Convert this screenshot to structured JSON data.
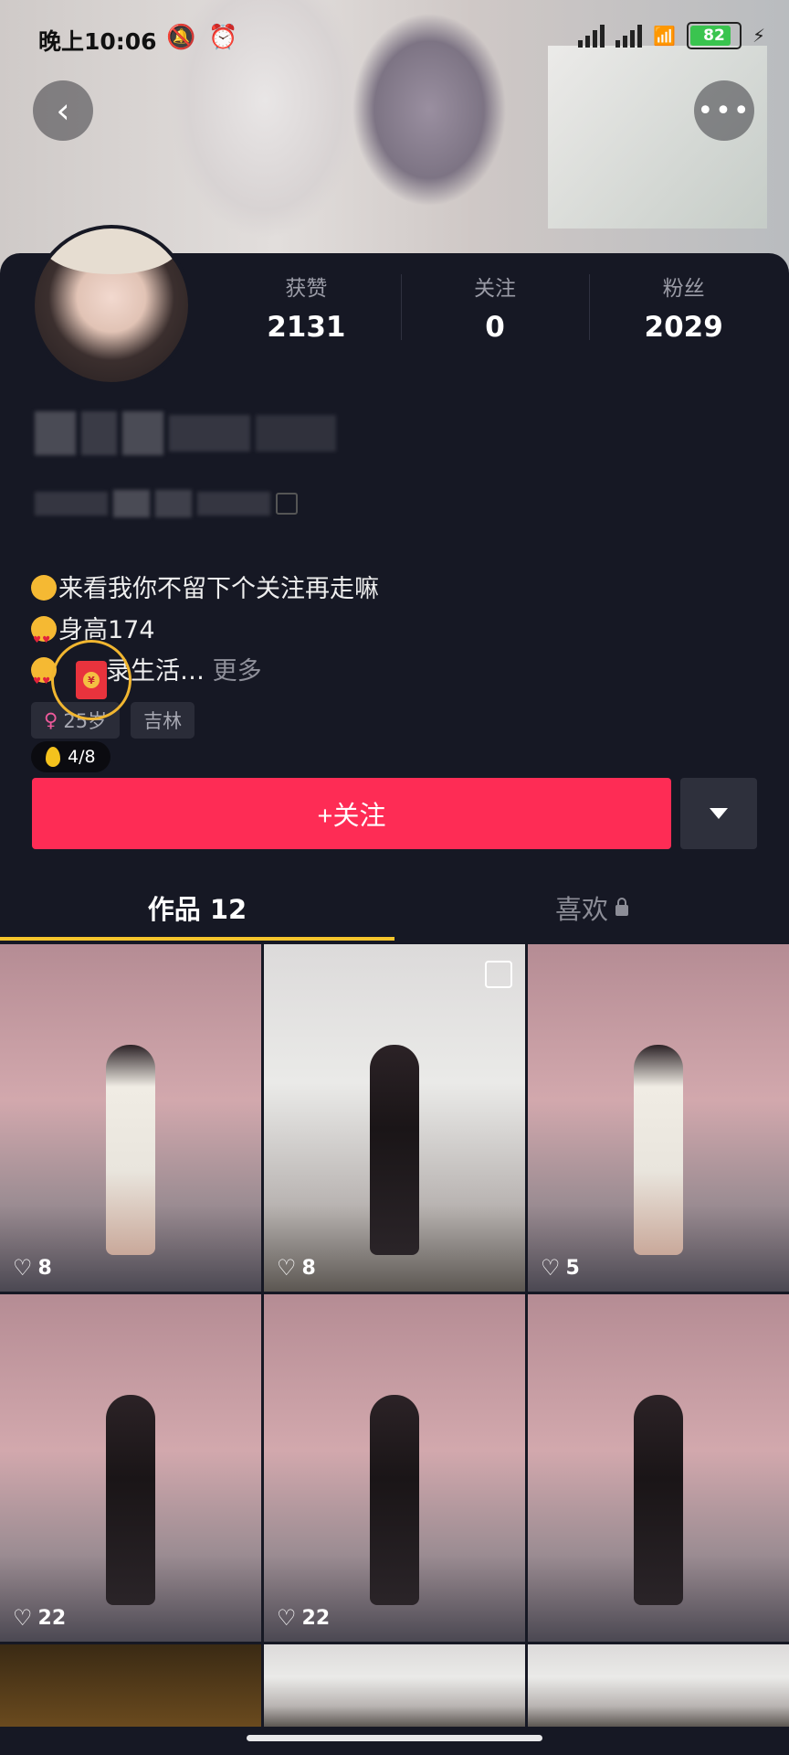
{
  "status_bar": {
    "time": "晚上10:06",
    "battery": "82"
  },
  "profile": {
    "stats": [
      {
        "label": "获赞",
        "value": "2131"
      },
      {
        "label": "关注",
        "value": "0"
      },
      {
        "label": "粉丝",
        "value": "2029"
      }
    ],
    "bio_lines": [
      "来看我你不留下个关注再走嘛",
      "身高174",
      "录生活…"
    ],
    "bio_more": "更多",
    "tags": {
      "age": "25岁",
      "location": "吉林"
    },
    "coin_progress": "4/8"
  },
  "actions": {
    "follow_label": "+关注"
  },
  "tabs": [
    {
      "label": "作品 12"
    },
    {
      "label": "喜欢"
    }
  ],
  "posts": [
    {
      "likes": "8"
    },
    {
      "likes": "8"
    },
    {
      "likes": "5"
    },
    {
      "likes": "22"
    },
    {
      "likes": "22"
    },
    {
      "likes": ""
    }
  ],
  "icons": {
    "back": "back-icon",
    "more": "more-icon",
    "copy": "copy-icon",
    "heart": "heart-icon",
    "lock": "lock-icon",
    "multi_image": "multi-image-icon"
  },
  "colors": {
    "accent": "#fe2c55",
    "tab_indicator": "#f6c52c",
    "background": "#161824"
  }
}
